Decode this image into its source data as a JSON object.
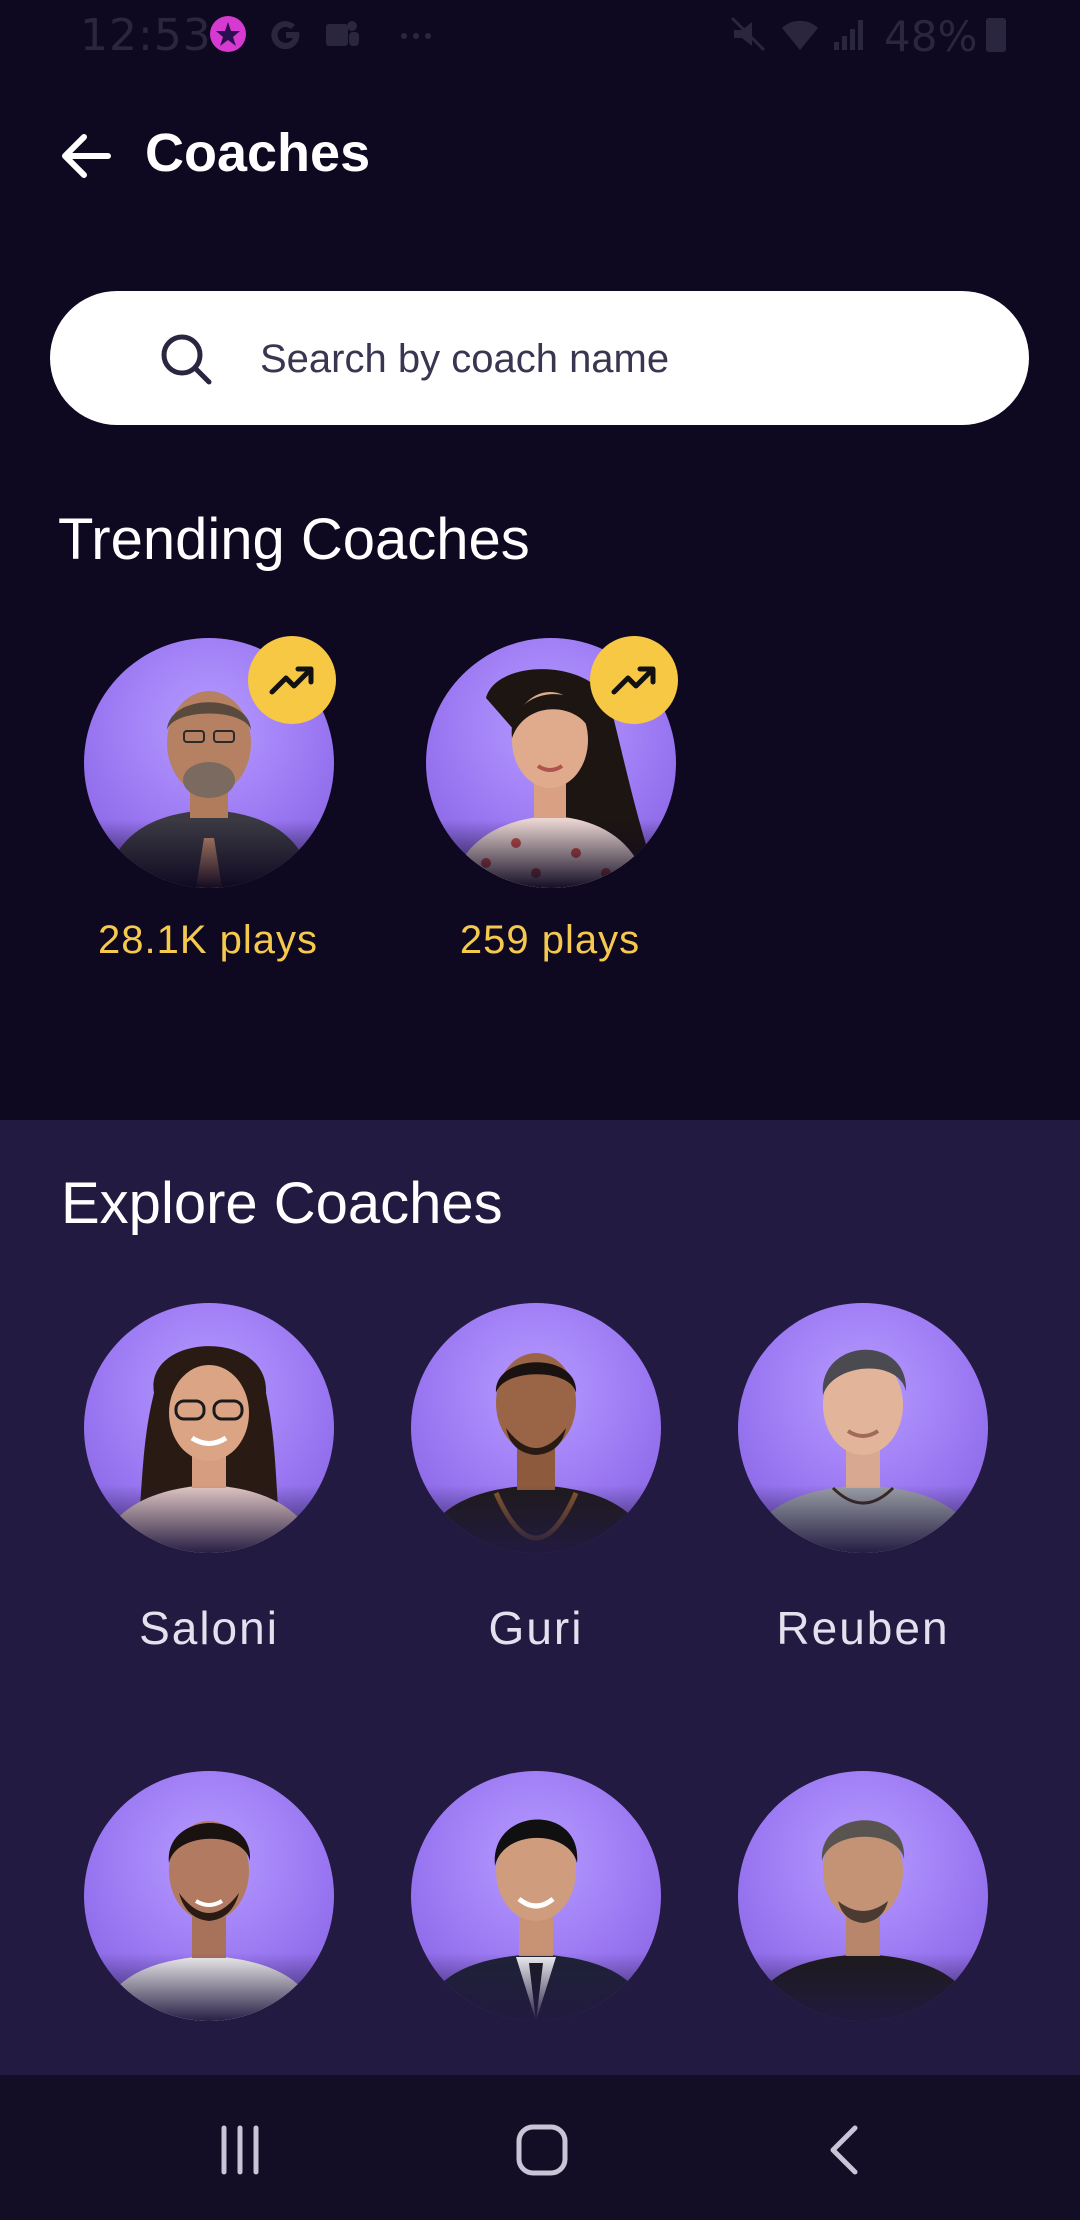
{
  "status_bar": {
    "time": "12:53",
    "battery": "48%",
    "icons": [
      "app-star-icon",
      "google-icon",
      "teams-icon",
      "more-dots-icon",
      "mute-icon",
      "wifi-icon",
      "signal-icon",
      "battery-icon"
    ]
  },
  "header": {
    "title": "Coaches",
    "back_icon": "arrow-left-icon"
  },
  "search": {
    "placeholder": "Search by coach name",
    "value": "",
    "icon": "search-icon"
  },
  "trending": {
    "title": "Trending Coaches",
    "badge_icon": "trending-up-icon",
    "items": [
      {
        "plays": "28.1K plays"
      },
      {
        "plays": "259 plays"
      }
    ]
  },
  "explore": {
    "title": "Explore Coaches",
    "coaches": [
      {
        "name": "Saloni"
      },
      {
        "name": "Guri"
      },
      {
        "name": "Reuben"
      },
      {
        "name": ""
      },
      {
        "name": ""
      },
      {
        "name": ""
      }
    ]
  },
  "nav_bar": {
    "icons": [
      "recent-apps-icon",
      "home-icon",
      "back-icon"
    ]
  },
  "colors": {
    "background": "#0e0820",
    "explore_background": "#221a40",
    "accent_yellow": "#f7c844",
    "plays_text": "#f5c94d",
    "avatar_purple": "#9a77f2"
  }
}
